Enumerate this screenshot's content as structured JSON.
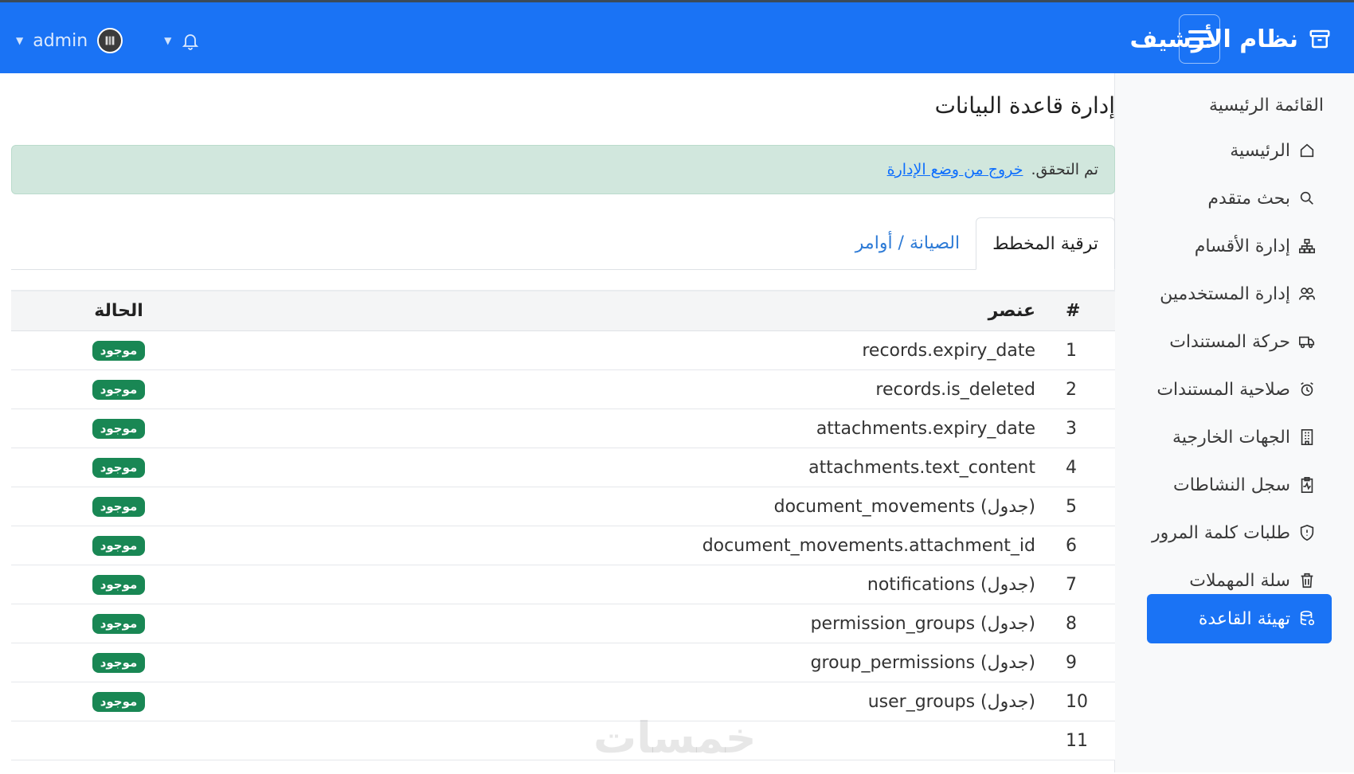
{
  "topbar": {
    "brand_title": "نظام الأرشيف",
    "user_name": "admin",
    "colors": {
      "bar": "#1a73f5"
    }
  },
  "sidebar": {
    "heading": "القائمة الرئيسية",
    "items": [
      {
        "label": "الرئيسية",
        "icon": "home-icon"
      },
      {
        "label": "بحث متقدم",
        "icon": "search-icon"
      },
      {
        "label": "إدارة الأقسام",
        "icon": "sitemap-icon"
      },
      {
        "label": "إدارة المستخدمين",
        "icon": "users-icon"
      },
      {
        "label": "حركة المستندات",
        "icon": "truck-icon"
      },
      {
        "label": "صلاحية المستندات",
        "icon": "alarm-icon"
      },
      {
        "label": "الجهات الخارجية",
        "icon": "building-icon"
      },
      {
        "label": "سجل النشاطات",
        "icon": "clipboard-pulse-icon"
      },
      {
        "label": "طلبات كلمة المرور",
        "icon": "shield-icon"
      },
      {
        "label": "سلة المهملات",
        "icon": "trash-icon"
      },
      {
        "label": "تهيئة القاعدة",
        "icon": "database-gear-icon",
        "active": true
      }
    ]
  },
  "main": {
    "title": "إدارة قاعدة البيانات",
    "alert": {
      "text": "تم التحقق.",
      "link": "خروج من وضع الإدارة"
    },
    "tabs": [
      {
        "label": "ترقية المخطط",
        "active": true
      },
      {
        "label": "الصيانة / أوامر",
        "active": false
      }
    ],
    "table": {
      "headers": {
        "num": "#",
        "item": "عنصر",
        "status": "الحالة"
      },
      "rows": [
        {
          "num": "1",
          "item": "records.expiry_date",
          "status": "موجود"
        },
        {
          "num": "2",
          "item": "records.is_deleted",
          "status": "موجود"
        },
        {
          "num": "3",
          "item": "attachments.expiry_date",
          "status": "موجود"
        },
        {
          "num": "4",
          "item": "attachments.text_content",
          "status": "موجود"
        },
        {
          "num": "5",
          "item": "document_movements (جدول)",
          "status": "موجود"
        },
        {
          "num": "6",
          "item": "document_movements.attachment_id",
          "status": "موجود"
        },
        {
          "num": "7",
          "item": "notifications (جدول)",
          "status": "موجود"
        },
        {
          "num": "8",
          "item": "permission_groups (جدول)",
          "status": "موجود"
        },
        {
          "num": "9",
          "item": "group_permissions (جدول)",
          "status": "موجود"
        },
        {
          "num": "10",
          "item": "user_groups (جدول)",
          "status": "موجود"
        },
        {
          "num": "11",
          "item": "",
          "status": ""
        }
      ]
    }
  },
  "watermark": "خمسات"
}
